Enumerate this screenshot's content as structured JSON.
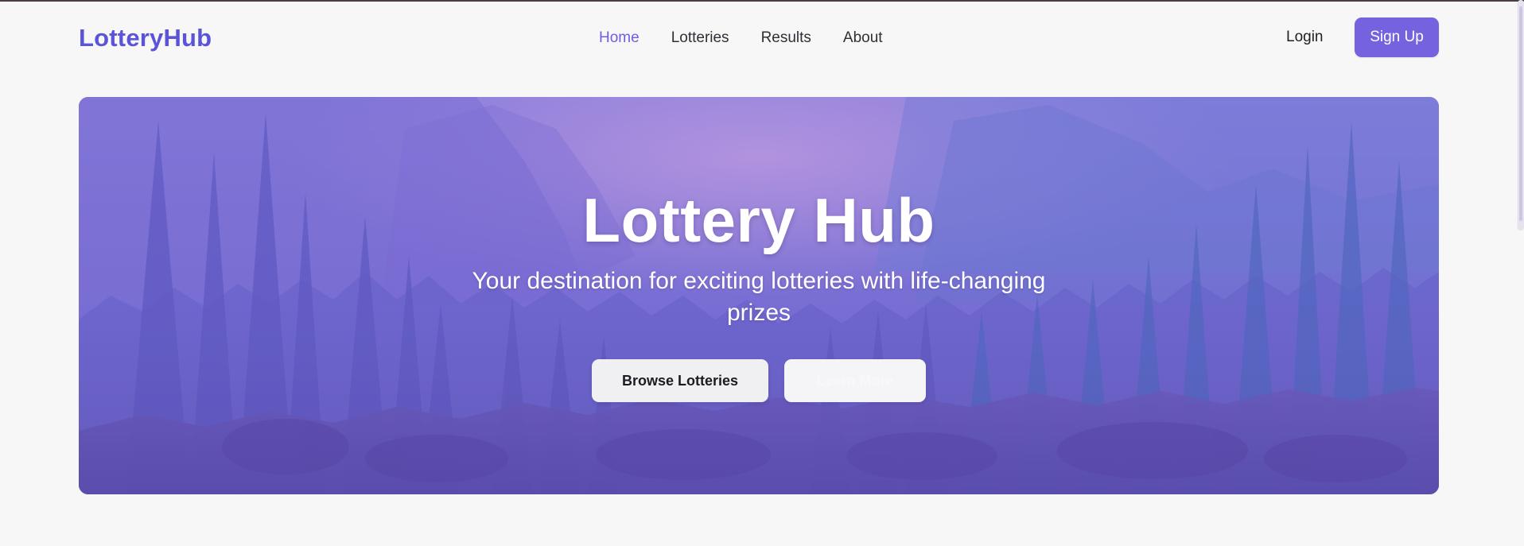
{
  "navbar": {
    "logo": "LotteryHub",
    "links": [
      {
        "label": "Home",
        "active": true
      },
      {
        "label": "Lotteries",
        "active": false
      },
      {
        "label": "Results",
        "active": false
      },
      {
        "label": "About",
        "active": false
      }
    ],
    "login_label": "Login",
    "signup_label": "Sign Up"
  },
  "hero": {
    "title": "Lottery Hub",
    "subtitle": "Your destination for exciting lotteries with life-changing prizes",
    "primary_button": "Browse Lotteries",
    "secondary_button": "Learn More"
  },
  "colors": {
    "brand": "#5b54d6",
    "accent": "#7562de",
    "hero_base": "#7368cf"
  }
}
